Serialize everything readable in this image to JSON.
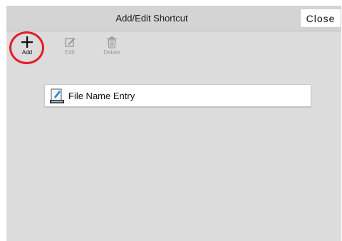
{
  "window": {
    "title": "Add/Edit Shortcut",
    "close_label": "Close"
  },
  "toolbar": {
    "add_label": "Add",
    "edit_label": "Edit",
    "delete_label": "Delete"
  },
  "shortcuts": [
    {
      "label": "File Name Entry",
      "icon": "file-name-entry-icon"
    }
  ],
  "colors": {
    "highlight": "#e21d2a",
    "panel": "#dcdcdc",
    "disabled_text": "#9a9a9a"
  }
}
